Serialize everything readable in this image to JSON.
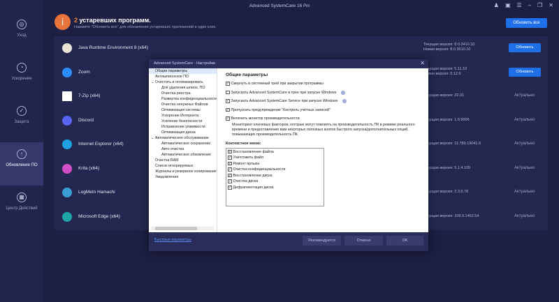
{
  "window": {
    "title": "Advanced SystemCare",
    "version": "16",
    "edition": "Pro"
  },
  "sidebar": {
    "items": [
      {
        "label": "Уход",
        "icon": "care-icon"
      },
      {
        "label": "Ускорение",
        "icon": "speedometer-icon"
      },
      {
        "label": "Защита",
        "icon": "shield-icon"
      },
      {
        "label": "Обновление ПО",
        "icon": "update-icon",
        "active": true
      },
      {
        "label": "Центр Действий",
        "icon": "grid-icon"
      }
    ]
  },
  "header": {
    "count": "2",
    "title": " устаревших программ.",
    "subtitle": "Нажмите \"Обновить все\" для обновления устаревших приложений в один клик.",
    "update_all": "Обновить все"
  },
  "apps": [
    {
      "name": "Java Runtime Environment 8 (x64)",
      "current": "Текущая версия: 8.0.3410.10",
      "new": "Новая версия: 8.0.3510.10",
      "action": "Обновить",
      "color": "#e9e4d8"
    },
    {
      "name": "Zoom",
      "current": "Текущая версия: 5.11.10",
      "new": "Новая версия: 5.12.6",
      "action": "Обновить",
      "color": "#2d8cff"
    },
    {
      "name": "7-Zip (x64)",
      "current": "Текущая версия: 22.01",
      "status": "Актуально",
      "color": "#ffffff"
    },
    {
      "name": "Discord",
      "current": "Текущая версия: 1.0.9006",
      "status": "Актуально",
      "color": "#5865f2"
    },
    {
      "name": "Internet Explorer (x64)",
      "current": "Текущая версия: 11.789.19041.0",
      "status": "Актуально",
      "color": "#1fa0e3"
    },
    {
      "name": "Krita (x64)",
      "current": "Текущая версия: 5.1.4.100",
      "status": "Актуально",
      "color": "#d04fc9"
    },
    {
      "name": "LogMeIn Hamachi",
      "current": "Текущая версия: 2.3.0.78",
      "status": "Актуально",
      "color": "#3d9bd6"
    },
    {
      "name": "Microsoft Edge (x64)",
      "current": "Текущая версия: 108.0.1462.54",
      "status": "Актуально",
      "color": "#1ea5a8"
    }
  ],
  "dialog": {
    "title": "Advanced SystemCare - Настройки",
    "tree": [
      {
        "label": "Общие параметры",
        "level": 1,
        "selected": true
      },
      {
        "label": "Антишпионское ПО",
        "level": 1
      },
      {
        "label": "Очистить и оптимизировать",
        "level": 0
      },
      {
        "label": "Для удаления шпион. ПО",
        "level": 2
      },
      {
        "label": "Очистка реестра",
        "level": 2
      },
      {
        "label": "Развертка конфиденциальности",
        "level": 2
      },
      {
        "label": "Очистка ненужных Файлов",
        "level": 2
      },
      {
        "label": "Оптимизация системы",
        "level": 2
      },
      {
        "label": "Ускорение Интернета",
        "level": 2
      },
      {
        "label": "Усиление безопасности",
        "level": 2
      },
      {
        "label": "Исправление уязвимости",
        "level": 2
      },
      {
        "label": "Оптимизация диска",
        "level": 2
      },
      {
        "label": "Автоматическое обслуживание",
        "level": 0
      },
      {
        "label": "Автоматическое сохранение",
        "level": 2
      },
      {
        "label": "Авто очистка",
        "level": 2
      },
      {
        "label": "Автоматическое обновление",
        "level": 2
      },
      {
        "label": "Очистка RAM",
        "level": 1
      },
      {
        "label": "Список игнорируемых",
        "level": 1
      },
      {
        "label": "Журналы и резервное копирование",
        "level": 1
      },
      {
        "label": "Уведомления",
        "level": 1
      }
    ],
    "heading": "Общие параметры",
    "options": [
      {
        "label": "Свернуть в системный трей при закрытии программы",
        "checked": true
      },
      {
        "label": "Запускать Advanced SystemCare в трее при запуске Windows",
        "checked": false,
        "info": true
      },
      {
        "label": "Запускать Advanced SystemCare Service при запуске Windows",
        "checked": true,
        "info": true
      },
      {
        "label": "Пропускать предупреждение \"Контроль учётных записей\"",
        "checked": true
      },
      {
        "label": "Включить монитор производительности",
        "checked": true
      }
    ],
    "monitor_desc": "Мониторинг ключевых факторов, которые могут повлиять на производительность ПК в режиме реального времени и предоставление вам некоторых полезных кнопок быстрого запуска/дополнительных опций, повышающих производительность ПК.",
    "context_label": "Контекстное меню:",
    "context_items": [
      "Восстановление файла",
      "Уничтожить файл",
      "Ремонт ярлыка",
      "Очистка конфиденциальности",
      "Восстановление диска",
      "Очистка диска",
      "Дефрагментация диска"
    ],
    "quick_link": "Быстрые параметры",
    "recommended": "Рекомендуется",
    "cancel": "Отмена",
    "ok": "OK"
  }
}
